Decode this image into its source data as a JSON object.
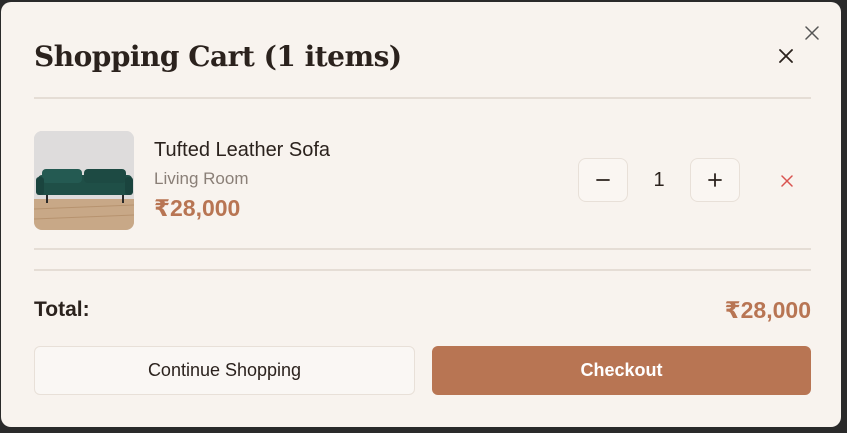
{
  "modal": {
    "title": "Shopping Cart (1 items)"
  },
  "cart": {
    "items": [
      {
        "name": "Tufted Leather Sofa",
        "category": "Living Room",
        "price": "₹28,000",
        "quantity": "1"
      }
    ]
  },
  "summary": {
    "total_label": "Total:",
    "total_value": "₹28,000"
  },
  "actions": {
    "continue_label": "Continue Shopping",
    "checkout_label": "Checkout"
  },
  "icons": {
    "outer_close": "close-icon",
    "header_close": "close-icon",
    "decrease": "minus-icon",
    "increase": "plus-icon",
    "remove": "remove-icon"
  },
  "colors": {
    "background": "#f8f3ee",
    "accent": "#b87553",
    "text": "#2b221d",
    "muted": "#8a7f77",
    "remove": "#d9534f"
  }
}
